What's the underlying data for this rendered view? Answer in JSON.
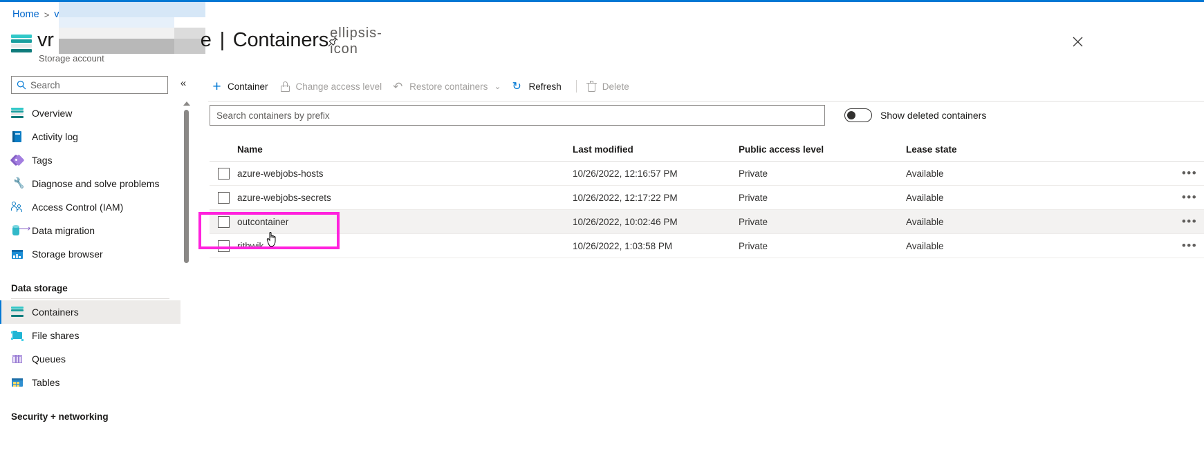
{
  "breadcrumb": {
    "home": "Home",
    "separator": ">",
    "redacted": "v"
  },
  "header": {
    "title_prefix": "vr",
    "title_suffix": "e",
    "pipe": "|",
    "section": "Containers",
    "subtitle": "Storage account",
    "pin_icon": "pin-icon",
    "more_icon": "ellipsis-icon",
    "close_icon": "close-icon"
  },
  "sidebar": {
    "search_placeholder": "Search",
    "search_value": "",
    "search_icon": "search-icon",
    "collapse_icon": "chevron-double-left-icon",
    "items": [
      {
        "label": "Overview",
        "icon": "containers-icon",
        "selected": false
      },
      {
        "label": "Activity log",
        "icon": "activity-log-icon",
        "selected": false
      },
      {
        "label": "Tags",
        "icon": "tags-icon",
        "selected": false
      },
      {
        "label": "Diagnose and solve problems",
        "icon": "wrench-icon",
        "selected": false
      },
      {
        "label": "Access Control (IAM)",
        "icon": "users-icon",
        "selected": false
      },
      {
        "label": "Data migration",
        "icon": "data-migration-icon",
        "selected": false
      },
      {
        "label": "Storage browser",
        "icon": "storage-browser-icon",
        "selected": false
      }
    ],
    "group_label": "Data storage",
    "storage_items": [
      {
        "label": "Containers",
        "icon": "containers-icon",
        "selected": true
      },
      {
        "label": "File shares",
        "icon": "file-shares-icon",
        "selected": false
      },
      {
        "label": "Queues",
        "icon": "queues-icon",
        "selected": false
      },
      {
        "label": "Tables",
        "icon": "tables-icon",
        "selected": false
      }
    ],
    "group_label_2": "Security + networking"
  },
  "toolbar": {
    "container_label": "Container",
    "change_access_label": "Change access level",
    "restore_label": "Restore containers",
    "refresh_label": "Refresh",
    "delete_label": "Delete",
    "plus_icon": "plus-icon",
    "lock_icon": "lock-icon",
    "undo_icon": "undo-icon",
    "refresh_icon": "refresh-icon",
    "trash_icon": "trash-icon",
    "chevron_icon": "chevron-down-icon"
  },
  "filters": {
    "prefix_placeholder": "Search containers by prefix",
    "prefix_value": "",
    "show_deleted_label": "Show deleted containers",
    "show_deleted_on": false
  },
  "table": {
    "columns": [
      "Name",
      "Last modified",
      "Public access level",
      "Lease state"
    ],
    "rows": [
      {
        "name": "azure-webjobs-hosts",
        "modified": "10/26/2022, 12:16:57 PM",
        "access": "Private",
        "lease": "Available",
        "menu": "•••",
        "highlighted": false
      },
      {
        "name": "azure-webjobs-secrets",
        "modified": "10/26/2022, 12:17:22 PM",
        "access": "Private",
        "lease": "Available",
        "menu": "•••",
        "highlighted": false
      },
      {
        "name": "outcontainer",
        "modified": "10/26/2022, 10:02:46 PM",
        "access": "Private",
        "lease": "Available",
        "menu": "•••",
        "highlighted": true
      },
      {
        "name": "rithwik",
        "modified": "10/26/2022, 1:03:58 PM",
        "access": "Private",
        "lease": "Available",
        "menu": "•••",
        "highlighted": false
      }
    ]
  },
  "annotation": {
    "highlight_color": "#ff22dd",
    "target_row": "outcontainer"
  },
  "colors": {
    "accent": "#0078d4",
    "link": "#0066cc",
    "selected_bg": "#edebe9",
    "row_hover_bg": "#f3f2f1"
  }
}
